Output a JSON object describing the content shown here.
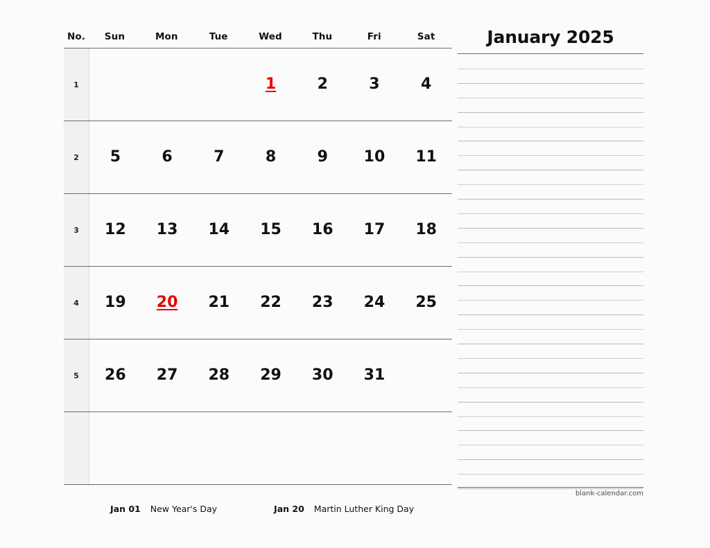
{
  "document": {
    "title": "January 2025",
    "watermark": "blank-calendar.com"
  },
  "colors": {
    "holiday": "#e60000",
    "text": "#111111",
    "rule_dark": "#6b6b6b",
    "rule_light": "#b8b8b8",
    "week_number_bg": "#f1f1f1",
    "page_bg": "#fbfbfb"
  },
  "weekday_header": {
    "number_label": "No.",
    "days": [
      "Sun",
      "Mon",
      "Tue",
      "Wed",
      "Thu",
      "Fri",
      "Sat"
    ]
  },
  "weeks": [
    {
      "number": "1",
      "days": [
        {
          "label": "",
          "holiday": false
        },
        {
          "label": "",
          "holiday": false
        },
        {
          "label": "",
          "holiday": false
        },
        {
          "label": "1",
          "holiday": true
        },
        {
          "label": "2",
          "holiday": false
        },
        {
          "label": "3",
          "holiday": false
        },
        {
          "label": "4",
          "holiday": false
        }
      ]
    },
    {
      "number": "2",
      "days": [
        {
          "label": "5",
          "holiday": false
        },
        {
          "label": "6",
          "holiday": false
        },
        {
          "label": "7",
          "holiday": false
        },
        {
          "label": "8",
          "holiday": false
        },
        {
          "label": "9",
          "holiday": false
        },
        {
          "label": "10",
          "holiday": false
        },
        {
          "label": "11",
          "holiday": false
        }
      ]
    },
    {
      "number": "3",
      "days": [
        {
          "label": "12",
          "holiday": false
        },
        {
          "label": "13",
          "holiday": false
        },
        {
          "label": "14",
          "holiday": false
        },
        {
          "label": "15",
          "holiday": false
        },
        {
          "label": "16",
          "holiday": false
        },
        {
          "label": "17",
          "holiday": false
        },
        {
          "label": "18",
          "holiday": false
        }
      ]
    },
    {
      "number": "4",
      "days": [
        {
          "label": "19",
          "holiday": false
        },
        {
          "label": "20",
          "holiday": true
        },
        {
          "label": "21",
          "holiday": false
        },
        {
          "label": "22",
          "holiday": false
        },
        {
          "label": "23",
          "holiday": false
        },
        {
          "label": "24",
          "holiday": false
        },
        {
          "label": "25",
          "holiday": false
        }
      ]
    },
    {
      "number": "5",
      "days": [
        {
          "label": "26",
          "holiday": false
        },
        {
          "label": "27",
          "holiday": false
        },
        {
          "label": "28",
          "holiday": false
        },
        {
          "label": "29",
          "holiday": false
        },
        {
          "label": "30",
          "holiday": false
        },
        {
          "label": "31",
          "holiday": false
        },
        {
          "label": "",
          "holiday": false
        }
      ]
    },
    {
      "number": "",
      "days": [
        {
          "label": "",
          "holiday": false
        },
        {
          "label": "",
          "holiday": false
        },
        {
          "label": "",
          "holiday": false
        },
        {
          "label": "",
          "holiday": false
        },
        {
          "label": "",
          "holiday": false
        },
        {
          "label": "",
          "holiday": false
        },
        {
          "label": "",
          "holiday": false
        }
      ]
    }
  ],
  "notes": {
    "line_count": 30
  },
  "holidays": [
    {
      "date": "Jan 01",
      "name": "New Year's Day"
    },
    {
      "date": "Jan 20",
      "name": "Martin Luther King Day"
    }
  ]
}
